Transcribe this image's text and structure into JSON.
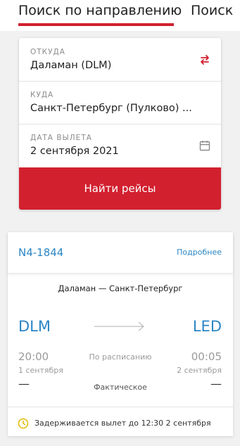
{
  "tabs": [
    {
      "label": "Поиск по направлению"
    },
    {
      "label": "Поиск"
    }
  ],
  "colors": {
    "accent": "#d2202f",
    "link": "#2b86c5",
    "delay_icon": "#e4b700"
  },
  "search": {
    "from": {
      "label": "ОТКУДА",
      "value": "Даламан (DLM)",
      "icon": "swap-icon"
    },
    "to": {
      "label": "КУДА",
      "value": "Санкт-Петербург (Пулково) ..."
    },
    "date": {
      "label": "ДАТА ВЫЛЕТА",
      "value": "2 сентября 2021",
      "icon": "calendar-icon"
    },
    "button": "Найти рейсы"
  },
  "flight": {
    "number": "N4-1844",
    "details_link": "Подробнее",
    "route": "Даламан — Санкт-Петербург",
    "departure": {
      "code": "DLM",
      "scheduled_time": "20:00",
      "scheduled_date": "1 сентября",
      "actual": "—"
    },
    "arrival": {
      "code": "LED",
      "scheduled_time": "00:05",
      "scheduled_date": "2 сентября",
      "actual": "—"
    },
    "scheduled_label": "По расписанию",
    "actual_label": "Фактическое",
    "status": "Задерживается вылет до  12:30  2 сентября"
  }
}
